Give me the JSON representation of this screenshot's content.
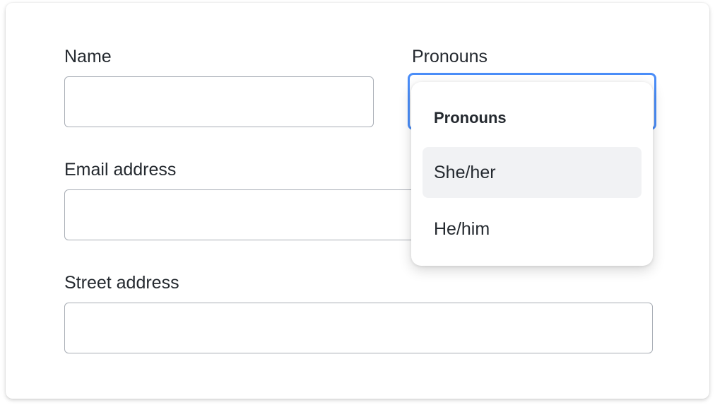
{
  "form": {
    "name": {
      "label": "Name",
      "value": ""
    },
    "pronouns": {
      "label": "Pronouns",
      "value": ""
    },
    "email": {
      "label": "Email address",
      "value": ""
    },
    "street": {
      "label": "Street address",
      "value": ""
    }
  },
  "dropdown": {
    "header": "Pronouns",
    "options": [
      {
        "label": "She/her",
        "highlighted": true
      },
      {
        "label": "He/him",
        "highlighted": false
      }
    ]
  },
  "colors": {
    "focus_border": "#4a8df8",
    "field_border": "#a8adb5",
    "highlight_bg": "#f1f2f4"
  }
}
